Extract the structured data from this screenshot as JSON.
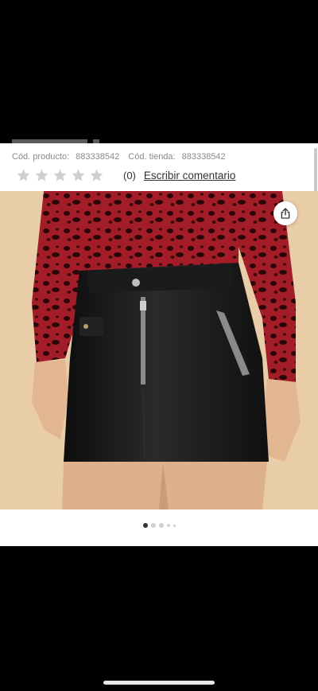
{
  "product": {
    "codes": [
      {
        "label": "Cód. producto:",
        "value": "883338542"
      },
      {
        "label": "Cód. tienda:",
        "value": "883338542"
      }
    ]
  },
  "rating": {
    "stars": 5,
    "filled": 0,
    "count_text": "(0)",
    "review_link": "Escribir comentario",
    "star_color": "#cfcfcf"
  },
  "icons": {
    "share": "share-icon",
    "star": "star-icon"
  },
  "carousel": {
    "total_dots": 5,
    "active_index": 0
  },
  "colors": {
    "text_muted": "#8a8a8a",
    "photo_background": "#e9cda9",
    "skirt": "#161616",
    "top": "#9d1a24"
  }
}
